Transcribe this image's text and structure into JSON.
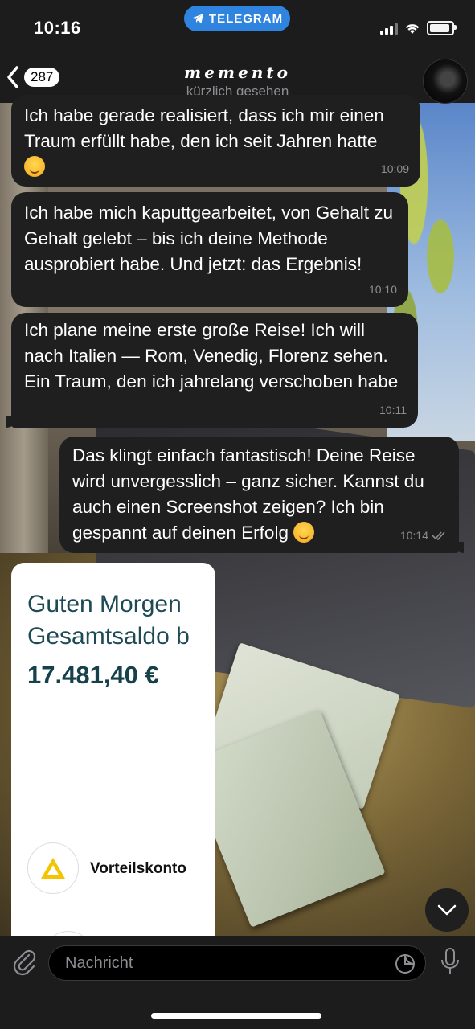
{
  "status": {
    "time": "10:16",
    "app_pill": "TELEGRAM"
  },
  "header": {
    "back_count": "287",
    "title": "memento",
    "subtitle": "kürzlich gesehen"
  },
  "messages": [
    {
      "direction": "incoming",
      "text": "Ich habe gerade realisiert, dass ich mir einen Traum erfüllt habe, den ich seit Jahren hatte",
      "emoji": "smiling-face",
      "time": "10:09"
    },
    {
      "direction": "incoming",
      "text": "Ich habe mich kaputtgearbeitet, von Gehalt zu Gehalt gelebt – bis ich deine Methode ausprobiert habe. Und jetzt: das Ergebnis!",
      "time": "10:10"
    },
    {
      "direction": "incoming",
      "text": "Ich plane meine erste große Reise! Ich will nach Italien — Rom, Venedig, Florenz sehen. Ein Traum, den ich jahrelang verschoben habe",
      "time": "10:11"
    },
    {
      "direction": "outgoing",
      "text": "Das klingt einfach fantastisch!  Deine Reise wird unvergesslich – ganz sicher. Kannst du auch einen Screenshot zeigen? Ich bin gespannt auf deinen Erfolg",
      "emoji": "star-struck",
      "time": "10:14",
      "read": true
    }
  ],
  "photo_card": {
    "greeting_line1": "Guten Morgen",
    "greeting_line2": "Gesamtsaldo b",
    "balance": "17.481,40 €",
    "account_name": "Vorteilskonto",
    "logo_color": "#f5c400"
  },
  "input": {
    "placeholder": "Nachricht"
  },
  "colors": {
    "accent": "#2f84e0",
    "bubble": "#1f1f20",
    "bar": "#1c1c1d"
  }
}
